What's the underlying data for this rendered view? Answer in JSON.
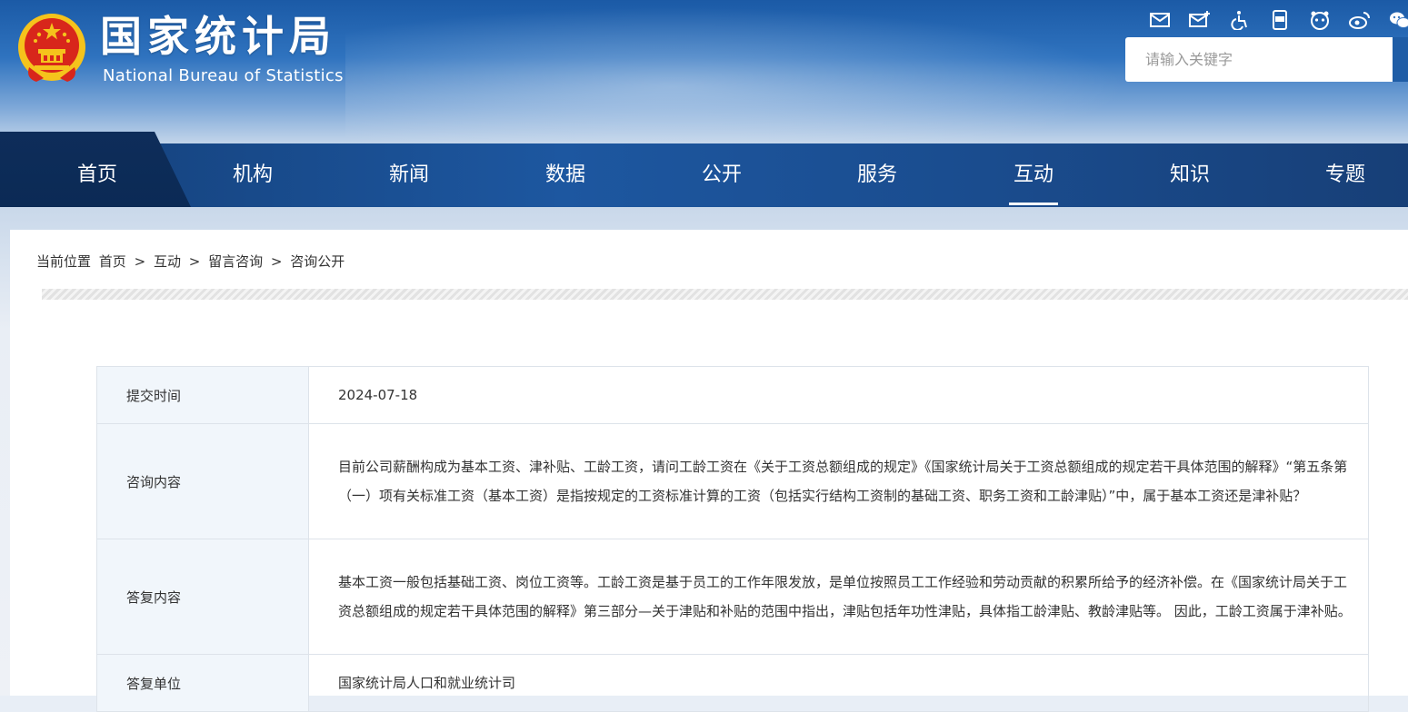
{
  "header": {
    "title_cn": "国家统计局",
    "title_en": "National Bureau of Statistics",
    "icons": [
      "mail-icon",
      "mail-plus-icon",
      "accessibility-icon",
      "app-icon",
      "mascot-icon",
      "weibo-icon",
      "wechat-icon"
    ],
    "search_placeholder": "请输入关键字"
  },
  "nav": {
    "items": [
      {
        "label": "首页"
      },
      {
        "label": "机构"
      },
      {
        "label": "新闻"
      },
      {
        "label": "数据"
      },
      {
        "label": "公开"
      },
      {
        "label": "服务"
      },
      {
        "label": "互动",
        "active": true
      },
      {
        "label": "知识"
      },
      {
        "label": "专题"
      }
    ]
  },
  "breadcrumb": {
    "prefix": "当前位置",
    "items": [
      "首页",
      "互动",
      "留言咨询",
      "咨询公开"
    ],
    "separator": ">"
  },
  "detail": {
    "rows": [
      {
        "label": "提交时间",
        "value": "2024-07-18"
      },
      {
        "label": "咨询内容",
        "value": "目前公司薪酬构成为基本工资、津补贴、工龄工资，请问工龄工资在《关于工资总额组成的规定》《国家统计局关于工资总额组成的规定若干具体范围的解释》“第五条第（一）项有关标准工资（基本工资）是指按规定的工资标准计算的工资（包括实行结构工资制的基础工资、职务工资和工龄津贴）”中，属于基本工资还是津补贴？"
      },
      {
        "label": "答复内容",
        "value": "基本工资一般包括基础工资、岗位工资等。工龄工资是基于员工的工作年限发放，是单位按照员工工作经验和劳动贡献的积累所给予的经济补偿。在《国家统计局关于工资总额组成的规定若干具体范围的解释》第三部分—关于津贴和补贴的范围中指出，津贴包括年功性津贴，具体指工龄津贴、教龄津贴等。 因此，工龄工资属于津补贴。"
      },
      {
        "label": "答复单位",
        "value": "国家统计局人口和就业统计司"
      }
    ]
  },
  "colors": {
    "header_blue": "#1b5aa6",
    "nav_blue": "#1d57a0",
    "label_bg": "#f1f6fb",
    "emblem_red": "#d8261b",
    "emblem_gold": "#f5c31c"
  }
}
